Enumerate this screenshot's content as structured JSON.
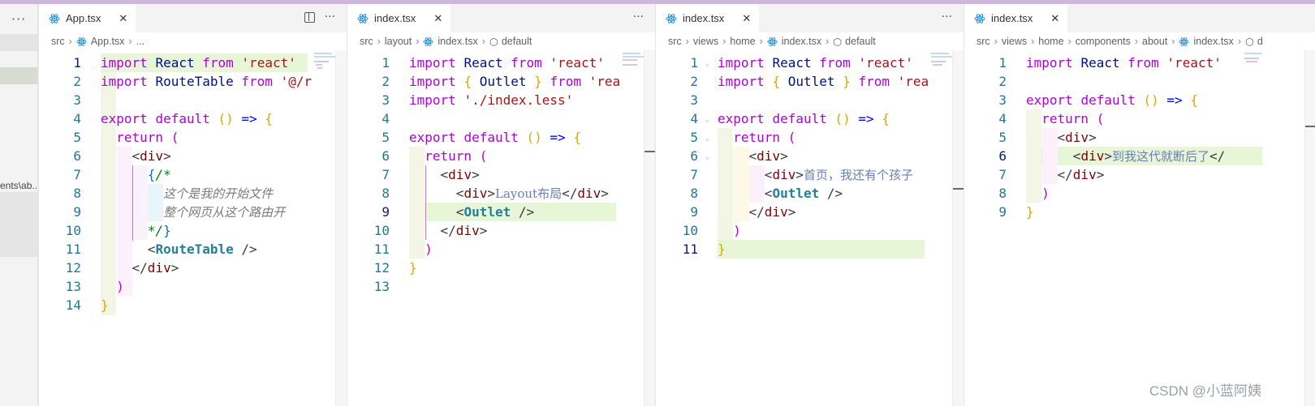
{
  "sidebar": {
    "fragment": "ents\\ab..."
  },
  "panes": [
    {
      "tab": "App.tsx",
      "breadcrumb": [
        "src",
        "App.tsx",
        "..."
      ],
      "lines": [
        {
          "n": "1",
          "t": "import React from 'react'"
        },
        {
          "n": "2",
          "t": "import RouteTable from '@/r"
        },
        {
          "n": "3",
          "t": ""
        },
        {
          "n": "4",
          "t": "export default () => {"
        },
        {
          "n": "5",
          "t": "  return ("
        },
        {
          "n": "6",
          "t": "    <div>"
        },
        {
          "n": "7",
          "t": "      {/*"
        },
        {
          "n": "8",
          "t": "        这个是我的开始文件"
        },
        {
          "n": "9",
          "t": "        整个网页从这个路由开"
        },
        {
          "n": "10",
          "t": "      */}"
        },
        {
          "n": "11",
          "t": "      <RouteTable />"
        },
        {
          "n": "12",
          "t": "    </div>"
        },
        {
          "n": "13",
          "t": "  )"
        },
        {
          "n": "14",
          "t": "}"
        }
      ]
    },
    {
      "tab": "index.tsx",
      "breadcrumb": [
        "src",
        "layout",
        "index.tsx",
        "default"
      ],
      "lines": [
        {
          "n": "1",
          "t": "import React from 'react'"
        },
        {
          "n": "2",
          "t": "import { Outlet } from 'rea"
        },
        {
          "n": "3",
          "t": "import './index.less'"
        },
        {
          "n": "4",
          "t": ""
        },
        {
          "n": "5",
          "t": "export default () => {"
        },
        {
          "n": "6",
          "t": "  return ("
        },
        {
          "n": "7",
          "t": "    <div>"
        },
        {
          "n": "8",
          "t": "      <div>Layout布局</div>"
        },
        {
          "n": "9",
          "t": "      <Outlet />"
        },
        {
          "n": "10",
          "t": "    </div>"
        },
        {
          "n": "11",
          "t": "  )"
        },
        {
          "n": "12",
          "t": "}"
        },
        {
          "n": "13",
          "t": ""
        }
      ]
    },
    {
      "tab": "index.tsx",
      "breadcrumb": [
        "src",
        "views",
        "home",
        "index.tsx",
        "default"
      ],
      "lines": [
        {
          "n": "1",
          "t": "import React from 'react'"
        },
        {
          "n": "2",
          "t": "import { Outlet } from 'rea"
        },
        {
          "n": "3",
          "t": ""
        },
        {
          "n": "4",
          "t": "export default () => {"
        },
        {
          "n": "5",
          "t": "  return ("
        },
        {
          "n": "6",
          "t": "    <div>"
        },
        {
          "n": "7",
          "t": "      <div>首页，我还有个孩子"
        },
        {
          "n": "8",
          "t": "      <Outlet />"
        },
        {
          "n": "9",
          "t": "    </div>"
        },
        {
          "n": "10",
          "t": "  )"
        },
        {
          "n": "11",
          "t": "}"
        }
      ]
    },
    {
      "tab": "index.tsx",
      "breadcrumb": [
        "src",
        "views",
        "home",
        "components",
        "about",
        "index.tsx",
        "d"
      ],
      "lines": [
        {
          "n": "1",
          "t": "import React from 'react'"
        },
        {
          "n": "2",
          "t": ""
        },
        {
          "n": "3",
          "t": "export default () => {"
        },
        {
          "n": "4",
          "t": "  return ("
        },
        {
          "n": "5",
          "t": "    <div>"
        },
        {
          "n": "6",
          "t": "      <div>到我这代就断后了</"
        },
        {
          "n": "7",
          "t": "    </div>"
        },
        {
          "n": "8",
          "t": "  )"
        },
        {
          "n": "9",
          "t": "}"
        }
      ]
    }
  ],
  "icons": {
    "tab_file": "react-icon",
    "symbol": "cube-icon",
    "split": "split-editor-icon",
    "more": "more-actions-icon",
    "close": "close-icon"
  },
  "watermark": "CSDN @小蓝阿姨"
}
